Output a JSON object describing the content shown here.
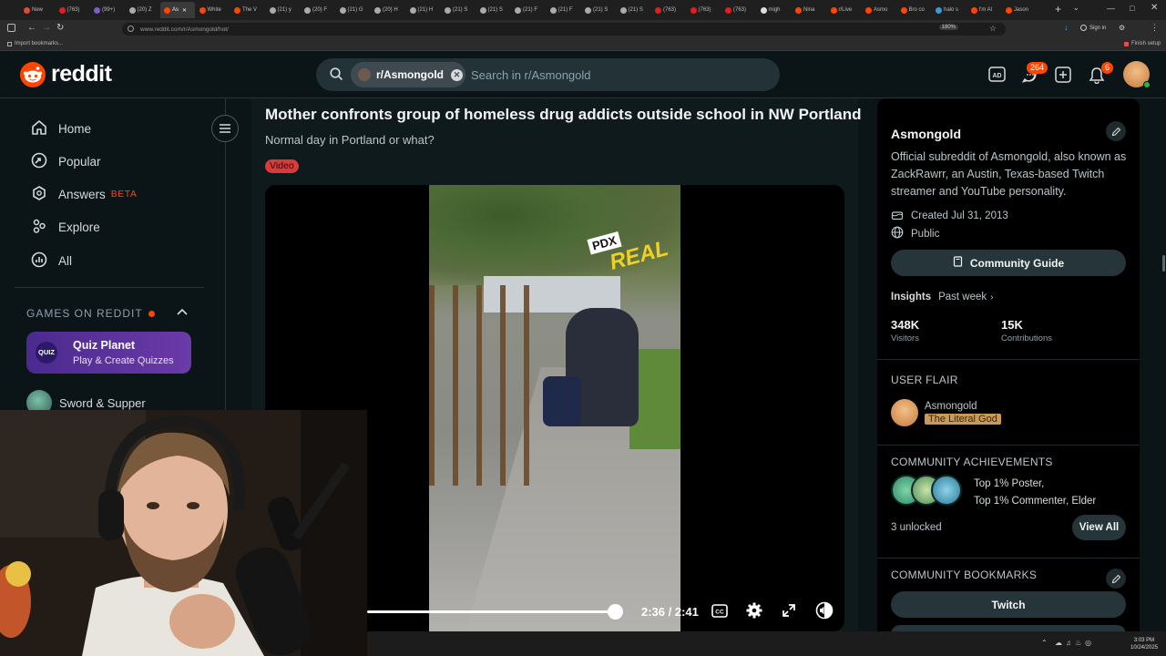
{
  "browser": {
    "tabs": [
      {
        "label": "New",
        "color": "#e04a3b"
      },
      {
        "label": "(763)",
        "color": "#e02020"
      },
      {
        "label": "(99+)",
        "color": "#7d5cd0"
      },
      {
        "label": "(20) Z",
        "color": "#aaaaaa"
      },
      {
        "label": "As",
        "color": "#ff4500",
        "active": true
      },
      {
        "label": "White",
        "color": "#ff4500"
      },
      {
        "label": "The V",
        "color": "#ff4500"
      },
      {
        "label": "(21) y",
        "color": "#aaaaaa"
      },
      {
        "label": "(20) F",
        "color": "#aaaaaa"
      },
      {
        "label": "(21) G",
        "color": "#aaaaaa"
      },
      {
        "label": "(20) H",
        "color": "#aaaaaa"
      },
      {
        "label": "(21) H",
        "color": "#aaaaaa"
      },
      {
        "label": "(21) S",
        "color": "#aaaaaa"
      },
      {
        "label": "(21) S",
        "color": "#aaaaaa"
      },
      {
        "label": "(21) F",
        "color": "#aaaaaa"
      },
      {
        "label": "(21) F",
        "color": "#aaaaaa"
      },
      {
        "label": "(21) S",
        "color": "#aaaaaa"
      },
      {
        "label": "(21) S",
        "color": "#aaaaaa"
      },
      {
        "label": "(763)",
        "color": "#e02020"
      },
      {
        "label": "(763)",
        "color": "#e02020"
      },
      {
        "label": "(763)",
        "color": "#e02020"
      },
      {
        "label": "migh",
        "color": "#dddddd"
      },
      {
        "label": "Nina",
        "color": "#ff4500"
      },
      {
        "label": "r/Live",
        "color": "#ff4500"
      },
      {
        "label": "Asmo",
        "color": "#ff4500"
      },
      {
        "label": "Bro co",
        "color": "#ff4500"
      },
      {
        "label": "halo s",
        "color": "#3a9ad9"
      },
      {
        "label": "I'm Al",
        "color": "#ff4500"
      },
      {
        "label": "Jason",
        "color": "#ff4500"
      }
    ],
    "url": "www.reddit.com/r/Asmongold/hot/",
    "zoom": "180%",
    "bookmarks_label": "Import bookmarks...",
    "finish_setup": "Finish setup",
    "sign_in": "Sign in"
  },
  "header": {
    "logo_text": "reddit",
    "search_chip": "r/Asmongold",
    "search_placeholder": "Search in r/Asmongold",
    "chat_count": "264",
    "notif_count": "6",
    "accent": "#ff4500"
  },
  "sidebar": {
    "items": [
      {
        "label": "Home",
        "icon": "home-icon"
      },
      {
        "label": "Popular",
        "icon": "popular-icon"
      },
      {
        "label": "Answers",
        "icon": "answers-icon",
        "badge": "BETA"
      },
      {
        "label": "Explore",
        "icon": "explore-icon"
      },
      {
        "label": "All",
        "icon": "all-icon"
      }
    ],
    "games_heading": "GAMES ON REDDIT",
    "games": [
      {
        "title": "Quiz Planet",
        "subtitle": "Play & Create Quizzes",
        "icon_text": "QUIZ"
      },
      {
        "title": "Sword & Supper"
      }
    ]
  },
  "post": {
    "title": "Mother confronts group of homeless drug addicts outside school in NW Portland",
    "subtitle": "Normal day in Portland or what?",
    "flair": "Video",
    "video": {
      "watermark_top": "PDX",
      "watermark_bottom": "REAL",
      "time": "2:36 / 2:41",
      "progress": 0.97
    }
  },
  "community": {
    "name": "Asmongold",
    "description": "Official subreddit of Asmongold, also known as ZackRawrr, an Austin, Texas-based Twitch streamer and YouTube personality.",
    "created": "Created Jul 31, 2013",
    "visibility": "Public",
    "guide_button": "Community Guide",
    "insights_label": "Insights",
    "insights_period": "Past week",
    "stats": [
      {
        "value": "348K",
        "label": "Visitors"
      },
      {
        "value": "15K",
        "label": "Contributions"
      }
    ],
    "user_flair_heading": "USER FLAIR",
    "flair_user": "Asmongold",
    "flair_tag": "The Literal God",
    "achievements_heading": "COMMUNITY ACHIEVEMENTS",
    "achievements_line1": "Top 1% Poster,",
    "achievements_line2": "Top 1% Commenter, Elder",
    "unlocked": "3 unlocked",
    "view_all": "View All",
    "bookmarks_heading": "COMMUNITY BOOKMARKS",
    "bookmark_button": "Twitch"
  },
  "taskbar": {
    "time": "3:03 PM",
    "date": "10/24/2025"
  }
}
